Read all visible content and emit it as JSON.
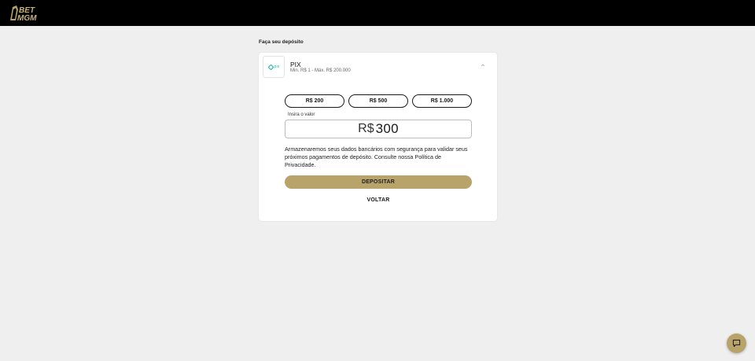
{
  "header": {
    "logo_alt": "BetMGM",
    "logo_line1": "BET",
    "logo_line2": "MGM"
  },
  "page": {
    "section_title": "Faça seu depósito"
  },
  "payment_method": {
    "logo_icon": "pix-logo-icon",
    "logo_text": "pix",
    "name": "PIX",
    "limits": "Min. R$ 1 - Máx. R$ 200.000",
    "expand_icon": "chevron-up-icon"
  },
  "amount_options": [
    {
      "label": "R$ 200"
    },
    {
      "label": "R$ 500"
    },
    {
      "label": "R$ 1.000"
    }
  ],
  "amount_input": {
    "label": "Insira o valor",
    "currency": "R$",
    "value": "300"
  },
  "notice": "Armazenaremos seus dados bancários com segurança para validar seus próximos pagamentos de depósito. Consulte nossa Política de Privacidade.",
  "actions": {
    "deposit_label": "DEPOSITAR",
    "back_label": "VOLTAR"
  },
  "chat": {
    "icon": "chat-icon"
  },
  "colors": {
    "brand_gold": "#b8a36a",
    "topbar": "#000000",
    "background": "#efefef",
    "pix_teal": "#2db7aa"
  }
}
